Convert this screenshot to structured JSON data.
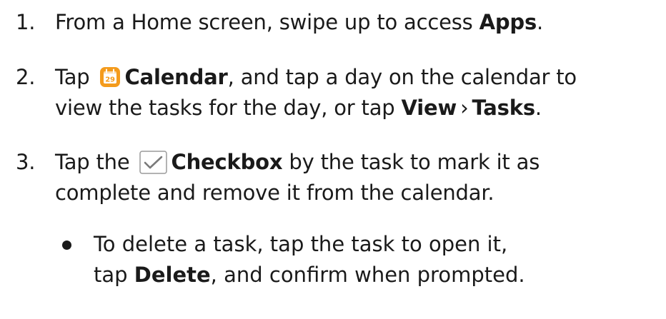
{
  "steps": [
    {
      "number": "1.",
      "text_a": "From a Home screen, swipe up to access ",
      "bold_a": "Apps",
      "text_b": "."
    },
    {
      "number": "2.",
      "text_a": "Tap ",
      "bold_a": "Calendar",
      "text_b": ", and tap a day on the calendar to",
      "text_c": "view the tasks for the day, or tap ",
      "bold_b": "View",
      "separator": "›",
      "bold_c": "Tasks",
      "text_d": "."
    },
    {
      "number": "3.",
      "text_a": "Tap the ",
      "bold_a": "Checkbox",
      "text_b": " by the task to mark it as",
      "text_c": "complete and remove it from the calendar."
    }
  ],
  "bullet": {
    "text_a": "To delete a task, tap the task to open it,",
    "text_b": "tap ",
    "bold_a": "Delete",
    "text_c": ", and confirm when prompted."
  },
  "icons": {
    "calendar": {
      "name": "calendar-icon",
      "day": "29",
      "color": "#f49b1c"
    },
    "checkbox": {
      "name": "checkbox-icon",
      "color": "#8a8a8a"
    }
  }
}
